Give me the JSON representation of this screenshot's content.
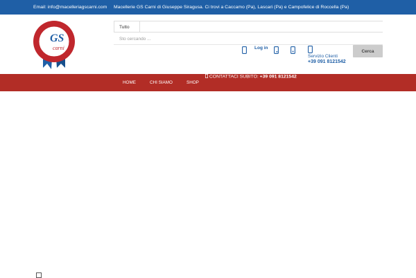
{
  "topbar": {
    "email": "Email: info@macelleriagscarni.com",
    "info": "Macellerie GS Carni di Giuseppe Siragusa. Ci trovi a Caccamo (Pa), Lascari (Pa) e Campofelice di Roccella (Pa)"
  },
  "logo": {
    "initials": "GS",
    "word": "carni"
  },
  "search": {
    "category": "Tutto",
    "placeholder": "Sto cercando ...",
    "button": "Cerca"
  },
  "header": {
    "login_label": "Log in",
    "service_label": "Servizio Clienti",
    "service_phone": "+39 091 8121542"
  },
  "nav": {
    "items": [
      {
        "label": "HOME"
      },
      {
        "label": "CHI SIAMO"
      },
      {
        "label": "SHOP"
      }
    ],
    "contact_label": "CONTATTACI SUBITO:",
    "contact_phone": "+39 091 8121542"
  },
  "colors": {
    "primary": "#1f5fa6",
    "nav_bg": "#b22d26",
    "button_bg": "#cccccc"
  }
}
